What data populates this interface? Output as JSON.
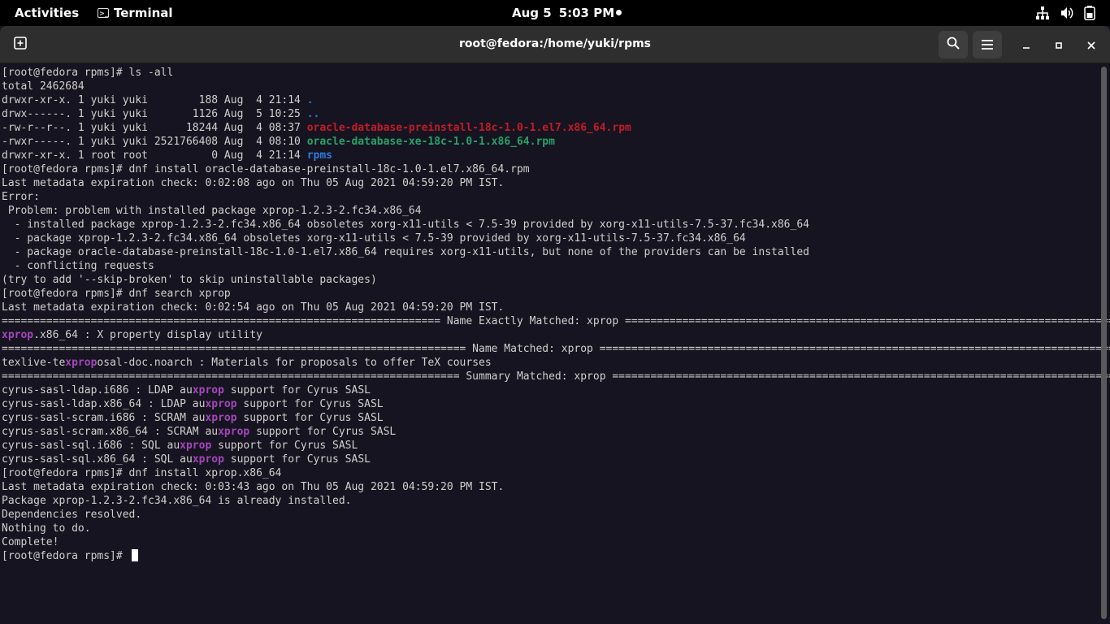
{
  "topbar": {
    "activities": "Activities",
    "app_name": "Terminal",
    "date": "Aug 5",
    "time": "5:03 PM",
    "icons": [
      "network-icon",
      "volume-icon",
      "battery-icon"
    ]
  },
  "window": {
    "title": "root@fedora:/home/yuki/rpms"
  },
  "terminal": {
    "l1": "[root@fedora rpms]# ls -all",
    "l2": "total 2462684",
    "l3a": "drwxr-xr-x. 1 yuki yuki        188 Aug  4 21:14 ",
    "l3b": ".",
    "l4a": "drwx------. 1 yuki yuki       1126 Aug  5 10:25 ",
    "l4b": "..",
    "l5a": "-rw-r--r--. 1 yuki yuki      18244 Aug  4 08:37 ",
    "l5b": "oracle-database-preinstall-18c-1.0-1.el7.x86_64.rpm",
    "l6a": "-rwxr-----. 1 yuki yuki 2521766408 Aug  4 08:10 ",
    "l6b": "oracle-database-xe-18c-1.0-1.x86_64.rpm",
    "l7a": "drwxr-xr-x. 1 root root          0 Aug  4 21:14 ",
    "l7b": "rpms",
    "l8": "[root@fedora rpms]# dnf install oracle-database-preinstall-18c-1.0-1.el7.x86_64.rpm",
    "l9": "Last metadata expiration check: 0:02:08 ago on Thu 05 Aug 2021 04:59:20 PM IST.",
    "l10": "Error:",
    "l11": " Problem: problem with installed package xprop-1.2.3-2.fc34.x86_64",
    "l12": "  - installed package xprop-1.2.3-2.fc34.x86_64 obsoletes xorg-x11-utils < 7.5-39 provided by xorg-x11-utils-7.5-37.fc34.x86_64",
    "l13": "  - package xprop-1.2.3-2.fc34.x86_64 obsoletes xorg-x11-utils < 7.5-39 provided by xorg-x11-utils-7.5-37.fc34.x86_64",
    "l14": "  - package oracle-database-preinstall-18c-1.0-1.el7.x86_64 requires xorg-x11-utils, but none of the providers can be installed",
    "l15": "  - conflicting requests",
    "l16": "(try to add '--skip-broken' to skip uninstallable packages)",
    "l17": "[root@fedora rpms]# dnf search xprop",
    "l18": "Last metadata expiration check: 0:02:54 ago on Thu 05 Aug 2021 04:59:20 PM IST.",
    "l19": "===================================================================== Name Exactly Matched: xprop ==============================================================================",
    "l20a": "xprop",
    "l20b": ".x86_64 : X property display utility",
    "l21": "========================================================================= Name Matched: xprop ==================================================================================",
    "l22a": "texlive-te",
    "l22b": "xprop",
    "l22c": "osal-doc.noarch : Materials for proposals to offer TeX courses",
    "l23": "======================================================================== Summary Matched: xprop ================================================================================",
    "l24a": "cyrus-sasl-ldap.i686 : LDAP au",
    "l24b": "xprop",
    "l24c": " support for Cyrus SASL",
    "l25a": "cyrus-sasl-ldap.x86_64 : LDAP au",
    "l25b": "xprop",
    "l25c": " support for Cyrus SASL",
    "l26a": "cyrus-sasl-scram.i686 : SCRAM au",
    "l26b": "xprop",
    "l26c": " support for Cyrus SASL",
    "l27a": "cyrus-sasl-scram.x86_64 : SCRAM au",
    "l27b": "xprop",
    "l27c": " support for Cyrus SASL",
    "l28a": "cyrus-sasl-sql.i686 : SQL au",
    "l28b": "xprop",
    "l28c": " support for Cyrus SASL",
    "l29a": "cyrus-sasl-sql.x86_64 : SQL au",
    "l29b": "xprop",
    "l29c": " support for Cyrus SASL",
    "l30": "[root@fedora rpms]# dnf install xprop.x86_64",
    "l31": "Last metadata expiration check: 0:03:43 ago on Thu 05 Aug 2021 04:59:20 PM IST.",
    "l32": "Package xprop-1.2.3-2.fc34.x86_64 is already installed.",
    "l33": "Dependencies resolved.",
    "l34": "Nothing to do.",
    "l35": "Complete!",
    "l36": "[root@fedora rpms]# "
  },
  "colors": {
    "background": "#171421",
    "directory": "#2a7bde",
    "rpm_file": "#c01c28",
    "executable": "#26a269",
    "match_highlight": "#a347ba"
  }
}
